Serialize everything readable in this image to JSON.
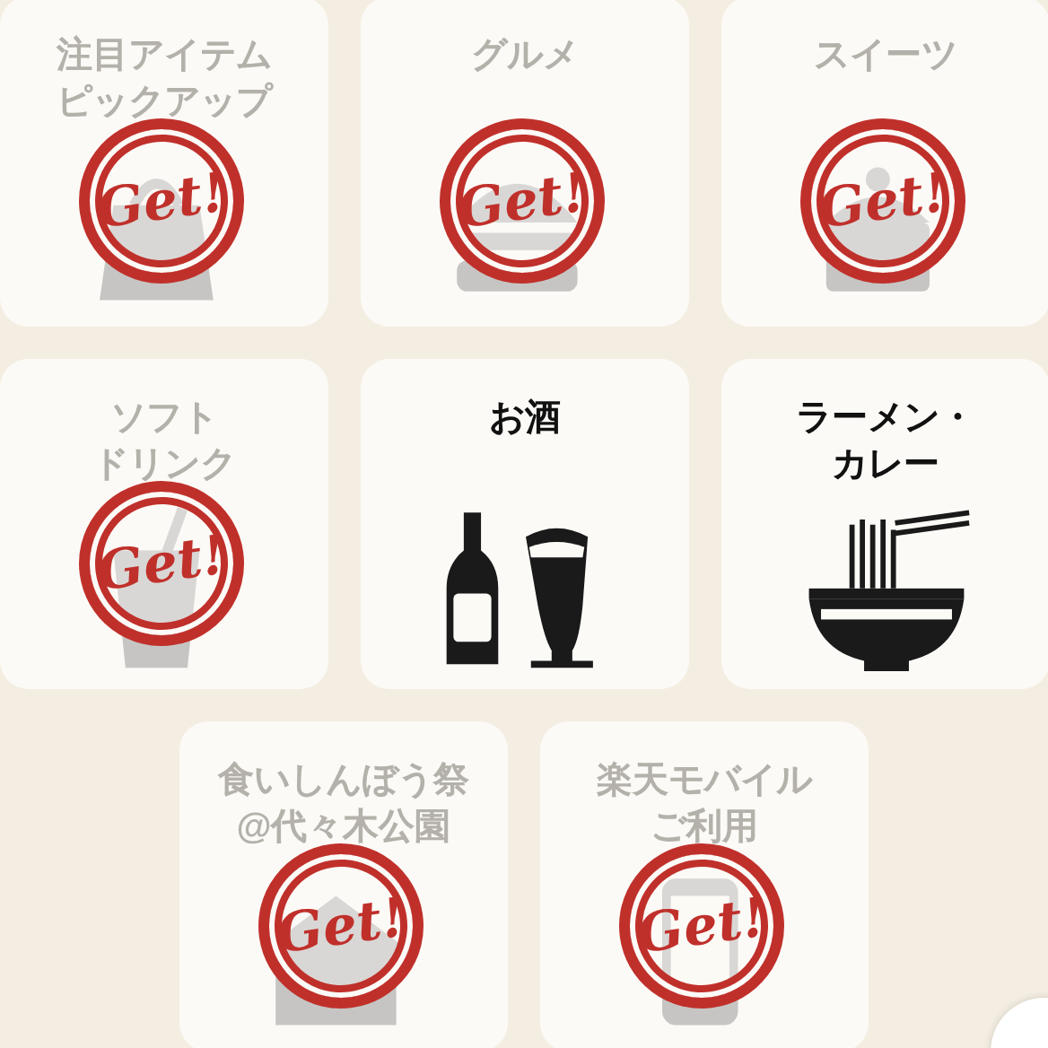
{
  "cards": [
    {
      "kind": "item",
      "label_lines": [
        "注目アイテム",
        "ピックアップ"
      ],
      "collected": true,
      "stamp": "Get!"
    },
    {
      "kind": "gourmet",
      "label_lines": [
        "グルメ"
      ],
      "collected": true,
      "stamp": "Get!"
    },
    {
      "kind": "sweets",
      "label_lines": [
        "スイーツ"
      ],
      "collected": true,
      "stamp": "Get!"
    },
    {
      "kind": "soft_drink",
      "label_lines": [
        "ソフト",
        "ドリンク"
      ],
      "collected": true,
      "stamp": "Get!"
    },
    {
      "kind": "sake",
      "label_lines": [
        "お酒"
      ],
      "collected": false
    },
    {
      "kind": "ramen",
      "label_lines": [
        "ラーメン・",
        "カレー"
      ],
      "collected": false
    },
    {
      "kind": "festival",
      "label_lines": [
        "食いしんぼう祭",
        "@代々木公園"
      ],
      "collected": true,
      "stamp": "Get!"
    },
    {
      "kind": "mobile",
      "label_lines": [
        "楽天モバイル",
        "ご利用"
      ],
      "collected": true,
      "stamp": "Get!"
    }
  ]
}
